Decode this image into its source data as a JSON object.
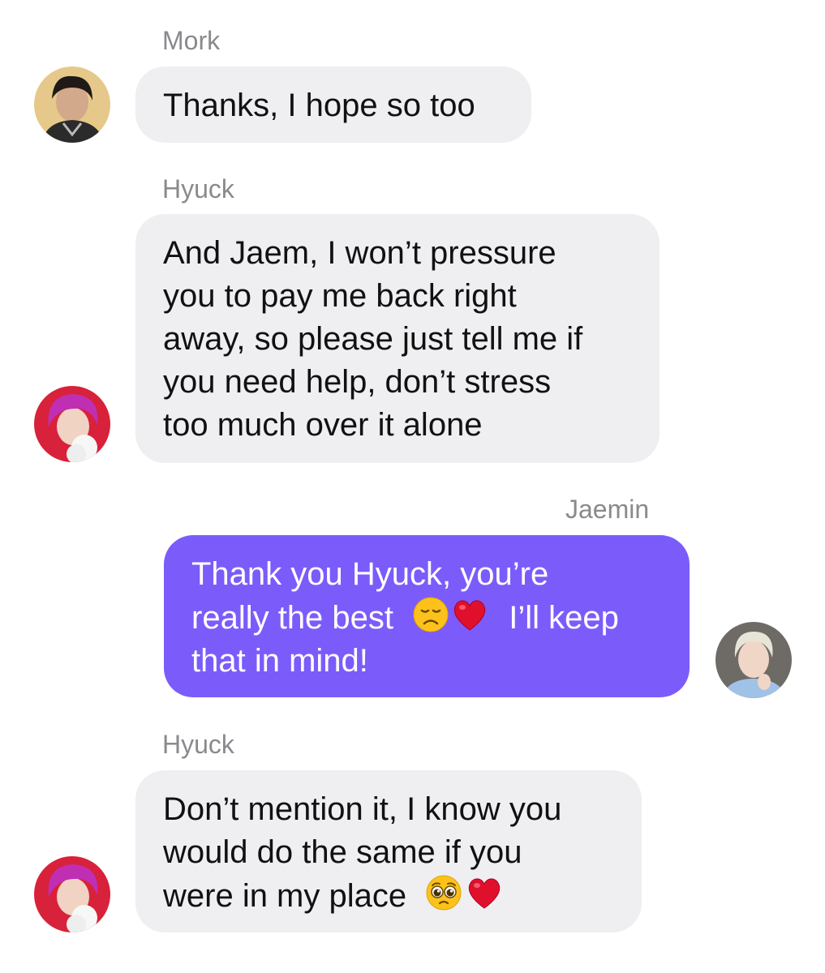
{
  "chat": {
    "messages": [
      {
        "sender": "Mork",
        "direction": "incoming",
        "lines": [
          "Thanks, I hope so too"
        ]
      },
      {
        "sender": "Hyuck",
        "direction": "incoming",
        "lines": [
          "And Jaem, I won’t pressure",
          "you to pay me back right",
          "away, so please just tell me if",
          "you need help, don’t stress",
          "too much over it alone"
        ]
      },
      {
        "sender": "Jaemin",
        "direction": "outgoing",
        "lines": [
          "Thank you Hyuck, you’re",
          "really the best",
          "I’ll keep",
          "that in mind!"
        ],
        "emojis": [
          "disappointed-face",
          "red-heart"
        ]
      },
      {
        "sender": "Hyuck",
        "direction": "incoming",
        "lines": [
          "Don’t mention it, I know you",
          "would do the same if you",
          "were in my place"
        ],
        "emojis": [
          "pleading-face",
          "red-heart"
        ]
      }
    ]
  },
  "colors": {
    "incoming_bubble": "#efeff2",
    "outgoing_bubble": "#7b5cfa",
    "sender_label": "#8a8a8e"
  }
}
